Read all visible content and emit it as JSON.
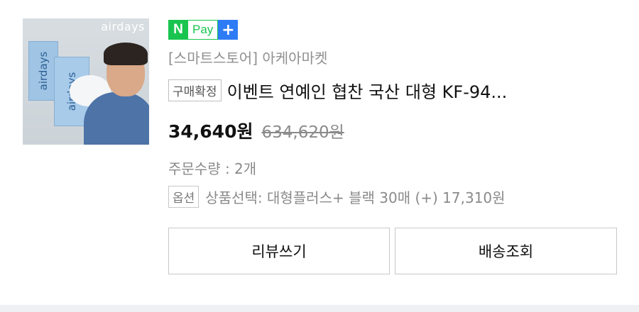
{
  "product_image": {
    "brand_text": "airdays",
    "box_label": "airdays"
  },
  "payment_badge": {
    "n": "N",
    "pay": "Pay",
    "plus": "+"
  },
  "store": {
    "name": "[스마트스토어] 아케아마켓"
  },
  "product": {
    "status_badge": "구매확정",
    "title": "이벤트 연예인 협찬 국산 대형 KF-94...",
    "price": "34,640원",
    "original_price": "634,620원",
    "quantity": "주문수량 : 2개",
    "option_badge": "옵션",
    "option_text": "상품선택: 대형플러스+ 블랙 30매 (+) 17,310원"
  },
  "actions": {
    "review_label": "리뷰쓰기",
    "shipping_label": "배송조회"
  },
  "colors": {
    "npay_green": "#19c54f",
    "plus_blue": "#2d7cf6"
  }
}
